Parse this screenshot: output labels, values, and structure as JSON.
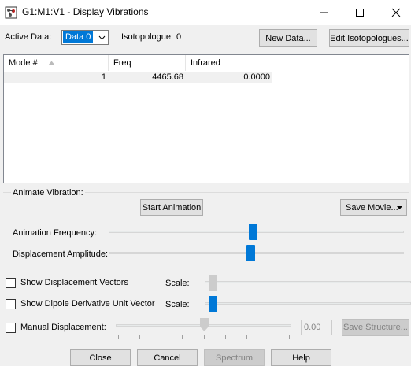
{
  "window": {
    "title": "G1:M1:V1 - Display Vibrations",
    "minimize_glyph": "—",
    "maximize_glyph": "☐",
    "close_glyph": "✕"
  },
  "top": {
    "active_data_label": "Active Data:",
    "active_data_value": "Data 0",
    "isotopologue_label": "Isotopologue:",
    "isotopologue_value": "0",
    "new_data_button": "New Data...",
    "edit_isotopologues_button": "Edit Isotopologues..."
  },
  "table": {
    "headers": [
      "Mode #",
      "Freq",
      "Infrared"
    ],
    "rows": [
      {
        "mode": "1",
        "freq": "4465.68",
        "infrared": "0.0000"
      }
    ]
  },
  "animate": {
    "group_label": "Animate Vibration:",
    "start_button": "Start Animation",
    "save_movie_button": "Save Movie...",
    "frequency_label": "Animation Frequency:",
    "frequency_level": 0.49,
    "amplitude_label": "Displacement Amplitude:",
    "amplitude_level": 0.48
  },
  "options": {
    "show_displacement_vectors_label": "Show Displacement Vectors",
    "show_dipole_label": "Show Dipole Derivative Unit Vector",
    "scale_label": "Scale:",
    "manual_displacement_label": "Manual Displacement:",
    "manual_displacement_value": "0.00",
    "save_structure_button": "Save Structure..."
  },
  "footer": {
    "close_button": "Close",
    "cancel_button": "Cancel",
    "spectrum_button": "Spectrum",
    "help_button": "Help"
  },
  "colors": {
    "accent": "#0078d7",
    "disabled": "#cccccc"
  }
}
